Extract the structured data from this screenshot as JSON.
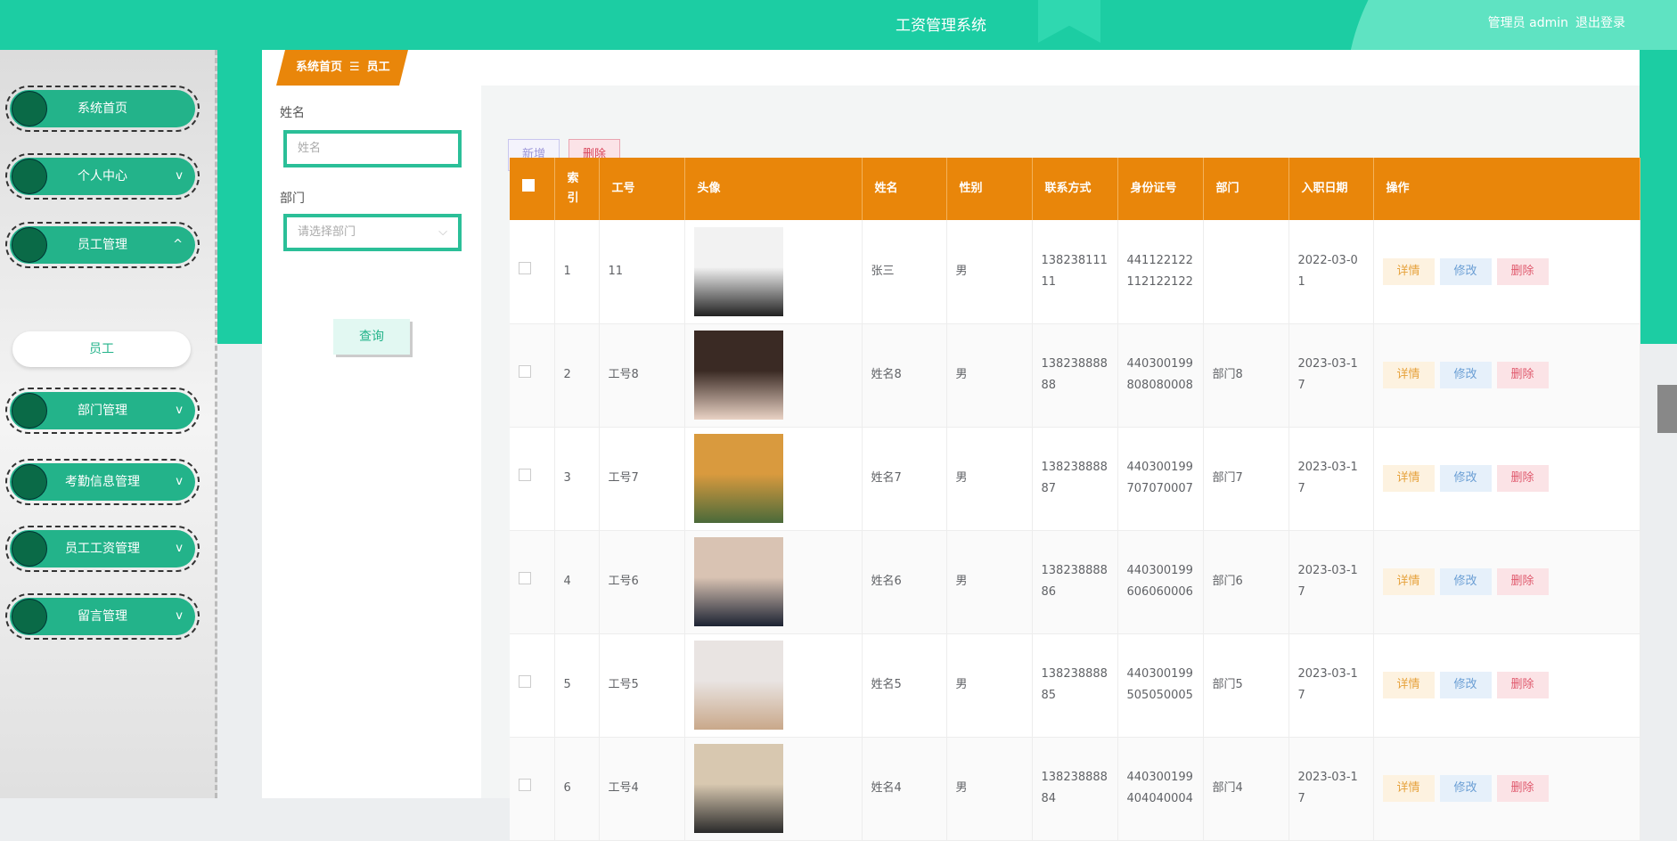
{
  "header": {
    "title": "工资管理系统",
    "user": "管理员 admin",
    "logout": "退出登录"
  },
  "sidebar": {
    "items": [
      {
        "label": "系统首页",
        "chevron": ""
      },
      {
        "label": "个人中心",
        "chevron": "v"
      },
      {
        "label": "员工管理",
        "chevron": "^"
      },
      {
        "label": "部门管理",
        "chevron": "v"
      },
      {
        "label": "考勤信息管理",
        "chevron": "v"
      },
      {
        "label": "员工工资管理",
        "chevron": "v"
      },
      {
        "label": "留言管理",
        "chevron": "v"
      }
    ],
    "sub_item": "员工"
  },
  "breadcrumb": {
    "home": "系统首页",
    "sep": "☰",
    "current": "员工"
  },
  "search": {
    "name_label": "姓名",
    "name_placeholder": "姓名",
    "dept_label": "部门",
    "dept_placeholder": "请选择部门",
    "query": "查询"
  },
  "toolbar": {
    "add": "新增",
    "delete": "删除"
  },
  "table": {
    "columns": [
      "索引",
      "工号",
      "头像",
      "姓名",
      "性别",
      "联系方式",
      "身份证号",
      "部门",
      "入职日期",
      "操作"
    ],
    "actions": {
      "detail": "详情",
      "edit": "修改",
      "delete": "删除"
    },
    "rows": [
      {
        "index": "1",
        "no": "11",
        "name": "张三",
        "gender": "男",
        "phone": "13823811111",
        "id": "441122122112122122",
        "dept": "",
        "date": "2022-03-01",
        "photo": [
          "#f2f2f2",
          "#222"
        ]
      },
      {
        "index": "2",
        "no": "工号8",
        "name": "姓名8",
        "gender": "男",
        "phone": "13823888888",
        "id": "440300199808080008",
        "dept": "部门8",
        "date": "2023-03-17",
        "photo": [
          "#3a2a24",
          "#e9d2c4"
        ]
      },
      {
        "index": "3",
        "no": "工号7",
        "name": "姓名7",
        "gender": "男",
        "phone": "13823888887",
        "id": "440300199707070007",
        "dept": "部门7",
        "date": "2023-03-17",
        "photo": [
          "#d99a3e",
          "#4a6a3a"
        ]
      },
      {
        "index": "4",
        "no": "工号6",
        "name": "姓名6",
        "gender": "男",
        "phone": "13823888886",
        "id": "440300199606060006",
        "dept": "部门6",
        "date": "2023-03-17",
        "photo": [
          "#d9c3b3",
          "#1d2333"
        ]
      },
      {
        "index": "5",
        "no": "工号5",
        "name": "姓名5",
        "gender": "男",
        "phone": "13823888885",
        "id": "440300199505050005",
        "dept": "部门5",
        "date": "2023-03-17",
        "photo": [
          "#e9e4e2",
          "#c9a88a"
        ]
      },
      {
        "index": "6",
        "no": "工号4",
        "name": "姓名4",
        "gender": "男",
        "phone": "13823888884",
        "id": "440300199404040004",
        "dept": "部门4",
        "date": "2023-03-17",
        "photo": [
          "#d8c8b0",
          "#2a2a2a"
        ]
      }
    ]
  }
}
